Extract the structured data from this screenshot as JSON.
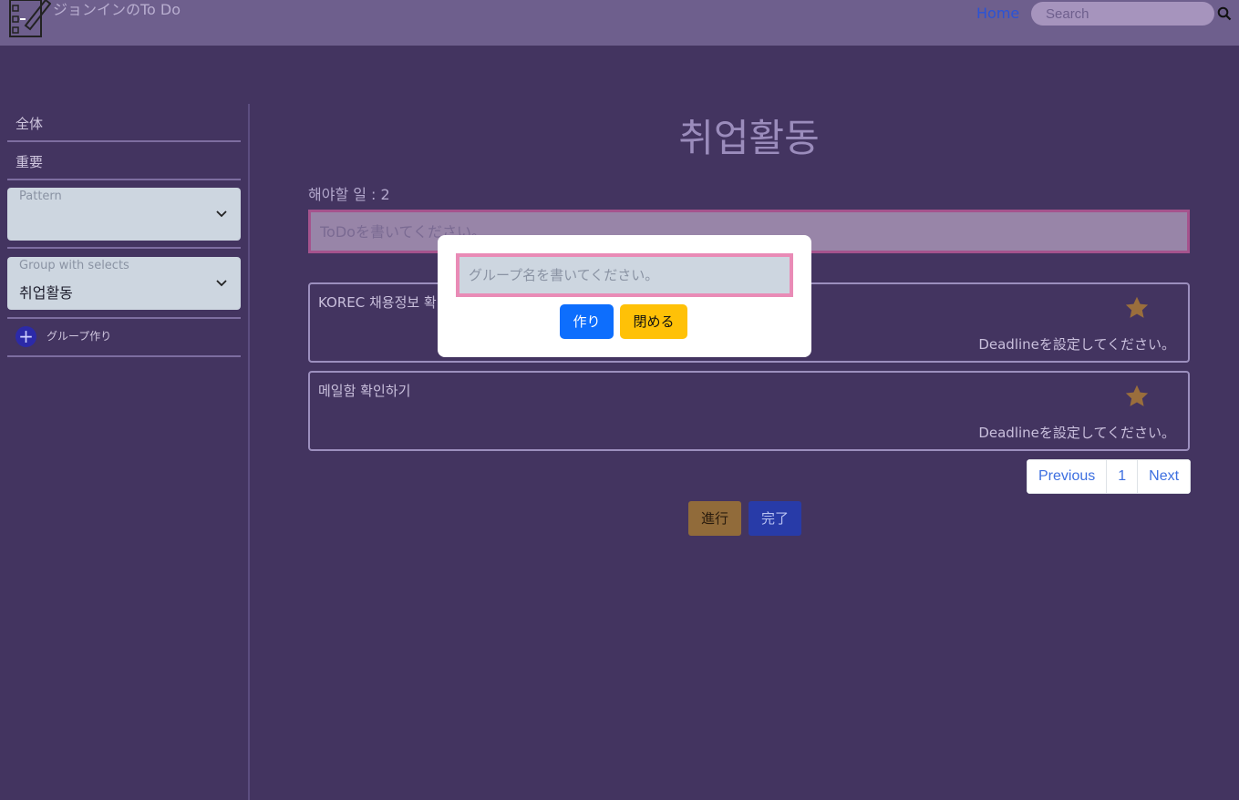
{
  "navbar": {
    "brand": "ジョンインのTo Do",
    "home_link": "Home",
    "search_placeholder": "Search"
  },
  "sidebar": {
    "items": [
      {
        "label": "全体"
      },
      {
        "label": "重要"
      }
    ],
    "pattern_select": {
      "label": "Pattern",
      "value": ""
    },
    "group_select": {
      "label": "Group with selects",
      "value": "취업활동"
    },
    "add_group_label": "グループ作り"
  },
  "main": {
    "title": "취업활동",
    "todo_count": "해야할 일 : 2",
    "todo_placeholder": "ToDoを書いてください。",
    "todos": [
      {
        "text": "KOREC 채용정보 확",
        "deadline": "Deadlineを設定してください。"
      },
      {
        "text": "메일함 확인하기",
        "deadline": "Deadlineを設定してください。"
      }
    ],
    "pagination": {
      "previous": "Previous",
      "page": "1",
      "next": "Next"
    },
    "buttons": {
      "progress": "進行",
      "done": "完了"
    }
  },
  "modal": {
    "input_placeholder": "グループ名を書いてください。",
    "create_label": "作り",
    "close_label": "閉める"
  },
  "colors": {
    "background": "#433460",
    "navbar": "#6e5f8d",
    "star": "#9a6e3c",
    "primary": "#0d6efd",
    "warning": "#ffc107"
  }
}
